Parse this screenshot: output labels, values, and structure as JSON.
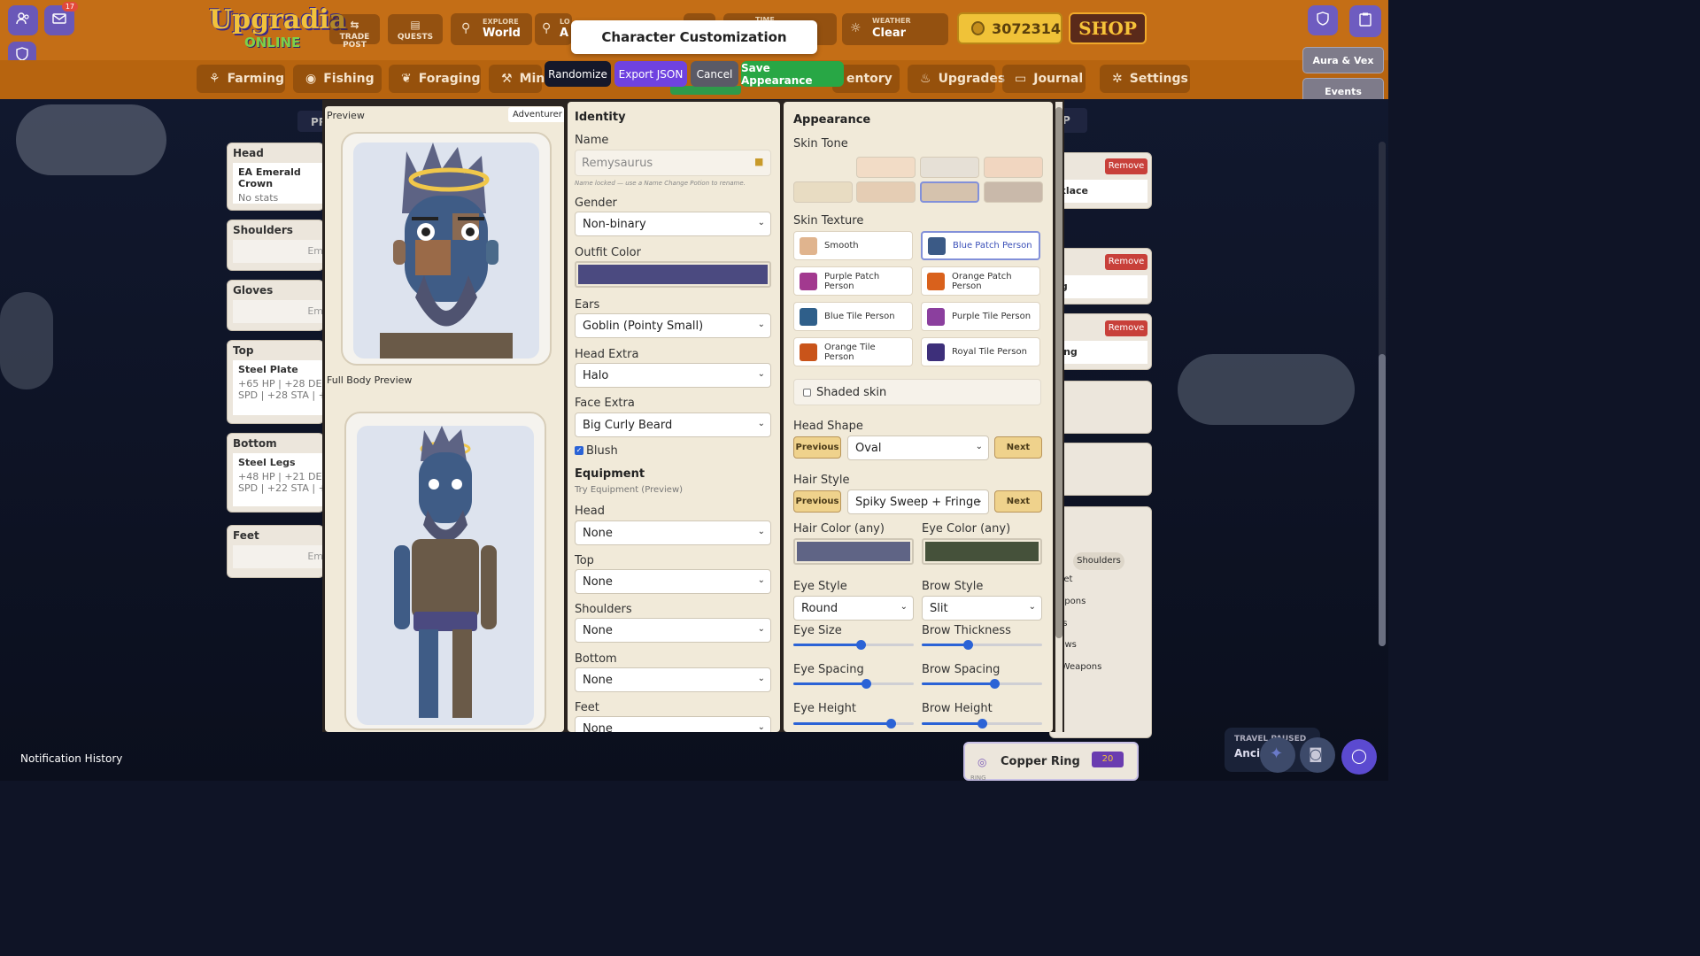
{
  "header": {
    "mail_badge": "17",
    "logo_line1": "Upgradia",
    "logo_line2": "ONLINE",
    "trade_post": "TRADE POST",
    "quests": "QUESTS",
    "explore_label": "EXPLORE",
    "explore_value": "World",
    "loc_label": "LO",
    "loc_value": "A",
    "time_label": "TIME",
    "weather_label": "WEATHER",
    "weather_value": "Clear",
    "gold": "3072314",
    "shop_label": "SHOP",
    "aura_btn": "Aura & Vex",
    "events_btn": "Events"
  },
  "nav": {
    "items": [
      "Farming",
      "Fishing",
      "Foraging",
      "Mini",
      "entory",
      "Upgrades",
      "Journal",
      "Settings"
    ]
  },
  "background": {
    "pr_tab": "PR",
    "p_tab": "P",
    "slots": [
      {
        "title": "Head",
        "item": "EA Emerald Crown",
        "stats": "No stats"
      },
      {
        "title": "Shoulders",
        "item": "Em"
      },
      {
        "title": "Gloves",
        "item": "Em"
      },
      {
        "title": "Top",
        "item": "Steel Plate",
        "stats": "+65 HP | +28 DEF |",
        "stats2": "SPD | +28 STA | +28"
      },
      {
        "title": "Bottom",
        "item": "Steel Legs",
        "stats": "+48 HP | +21 DEF |",
        "stats2": "SPD | +22 STA | +22"
      },
      {
        "title": "Feet",
        "item": "Em"
      }
    ],
    "right_items": [
      "cklace",
      "ng",
      "king"
    ],
    "remove_label": "Remove",
    "filters": [
      "Shoulders",
      "Feet",
      "eapons",
      "rds",
      "bows",
      "c Weapons"
    ],
    "copper_ring": "Copper Ring",
    "copper_ring_sub": "RING",
    "copper_count": "20",
    "travel_paused": "TRAVEL PAUSED",
    "travel_sub": "Ancien",
    "notification_history": "Notification History"
  },
  "modal": {
    "title": "Character Customization",
    "buttons": {
      "randomize": "Randomize",
      "export": "Export JSON",
      "cancel": "Cancel",
      "save": "Save Appearance"
    },
    "preview": {
      "title": "Preview",
      "badge": "Adventurer",
      "full_body": "Full Body Preview"
    },
    "identity": {
      "title": "Identity",
      "name_label": "Name",
      "name_value": "Remysaurus",
      "name_note": "Name locked — use a Name Change Potion to rename.",
      "gender_label": "Gender",
      "gender_value": "Non-binary",
      "outfit_label": "Outfit Color",
      "outfit_color": "#4b4a80",
      "ears_label": "Ears",
      "ears_value": "Goblin (Pointy Small)",
      "head_extra_label": "Head Extra",
      "head_extra_value": "Halo",
      "face_extra_label": "Face Extra",
      "face_extra_value": "Big Curly Beard",
      "blush_label": "Blush",
      "equipment_title": "Equipment",
      "equipment_sub": "Try Equipment (Preview)",
      "head_label": "Head",
      "head_value": "None",
      "top_label": "Top",
      "top_value": "None",
      "shoulders_label": "Shoulders",
      "shoulders_value": "None",
      "bottom_label": "Bottom",
      "bottom_value": "None",
      "feet_label": "Feet",
      "feet_value": "None"
    },
    "appearance": {
      "title": "Appearance",
      "skin_tone_label": "Skin Tone",
      "skin_tones": [
        "#f2dcc6",
        "#e6e0d6",
        "#f1d6c0",
        "#e8dcc2",
        "#e5cdb4",
        "#d5c2ad",
        "#c9b9aa"
      ],
      "skin_texture_label": "Skin Texture",
      "textures": [
        {
          "label": "Smooth",
          "color": "#e0b48e"
        },
        {
          "label": "Blue Patch Person",
          "color": "#3b5a86"
        },
        {
          "label": "Purple Patch Person",
          "color": "#a2398f"
        },
        {
          "label": "Orange Patch Person",
          "color": "#d9611c"
        },
        {
          "label": "Blue Tile Person",
          "color": "#2f5f8a"
        },
        {
          "label": "Purple Tile Person",
          "color": "#8b3f9e"
        },
        {
          "label": "Orange Tile Person",
          "color": "#c9541a"
        },
        {
          "label": "Royal Tile Person",
          "color": "#3d2f7a"
        }
      ],
      "shaded_skin": "Shaded skin",
      "head_shape_label": "Head Shape",
      "head_shape_value": "Oval",
      "prev_label": "Previous",
      "next_label": "Next",
      "hair_style_label": "Hair Style",
      "hair_style_value": "Spiky Sweep + Fringe",
      "hair_color_label": "Hair Color (any)",
      "hair_color": "#5f6485",
      "eye_color_label": "Eye Color (any)",
      "eye_color": "#45513a",
      "eye_style_label": "Eye Style",
      "eye_style_value": "Round",
      "brow_style_label": "Brow Style",
      "brow_style_value": "Slit",
      "eye_size_label": "Eye Size",
      "eye_size": 0.56,
      "brow_thickness_label": "Brow Thickness",
      "brow_thickness": 0.38,
      "eye_spacing_label": "Eye Spacing",
      "eye_spacing": 0.6,
      "brow_spacing_label": "Brow Spacing",
      "brow_spacing": 0.6,
      "eye_height_label": "Eye Height",
      "eye_height": 0.81,
      "brow_height_label": "Brow Height",
      "brow_height": 0.5
    }
  }
}
